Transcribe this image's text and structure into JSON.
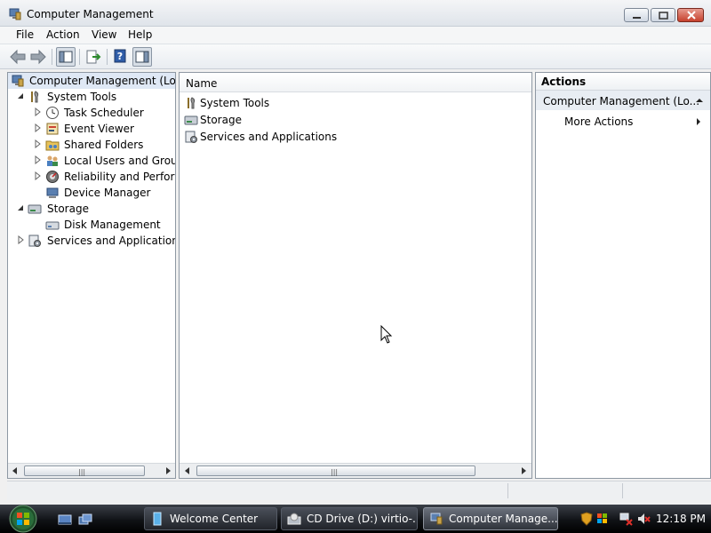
{
  "window": {
    "title": "Computer Management",
    "menu": [
      "File",
      "Action",
      "View",
      "Help"
    ]
  },
  "tree": {
    "root": "Computer Management (Local)",
    "items": [
      {
        "label": "System Tools",
        "expanded": true,
        "icon": "system-tools-icon"
      },
      {
        "label": "Task Scheduler",
        "icon": "clock-icon"
      },
      {
        "label": "Event Viewer",
        "icon": "event-viewer-icon"
      },
      {
        "label": "Shared Folders",
        "icon": "shared-folders-icon"
      },
      {
        "label": "Local Users and Groups",
        "icon": "users-icon"
      },
      {
        "label": "Reliability and Performance",
        "icon": "performance-icon"
      },
      {
        "label": "Device Manager",
        "icon": "device-manager-icon"
      },
      {
        "label": "Storage",
        "expanded": true,
        "icon": "storage-icon"
      },
      {
        "label": "Disk Management",
        "icon": "disk-icon"
      },
      {
        "label": "Services and Applications",
        "expanded": false,
        "icon": "services-icon"
      }
    ]
  },
  "list": {
    "column": "Name",
    "rows": [
      "System Tools",
      "Storage",
      "Services and Applications"
    ]
  },
  "actions": {
    "header": "Actions",
    "section": "Computer Management (Lo...",
    "more": "More Actions"
  },
  "taskbar": {
    "buttons": [
      "Welcome Center",
      "CD Drive (D:) virtio-...",
      "Computer Manage..."
    ],
    "clock": "12:18 PM"
  },
  "colors": {
    "selection": "#dfe8f5",
    "accent": "#3a6ea5",
    "taskbar": "#101216"
  }
}
